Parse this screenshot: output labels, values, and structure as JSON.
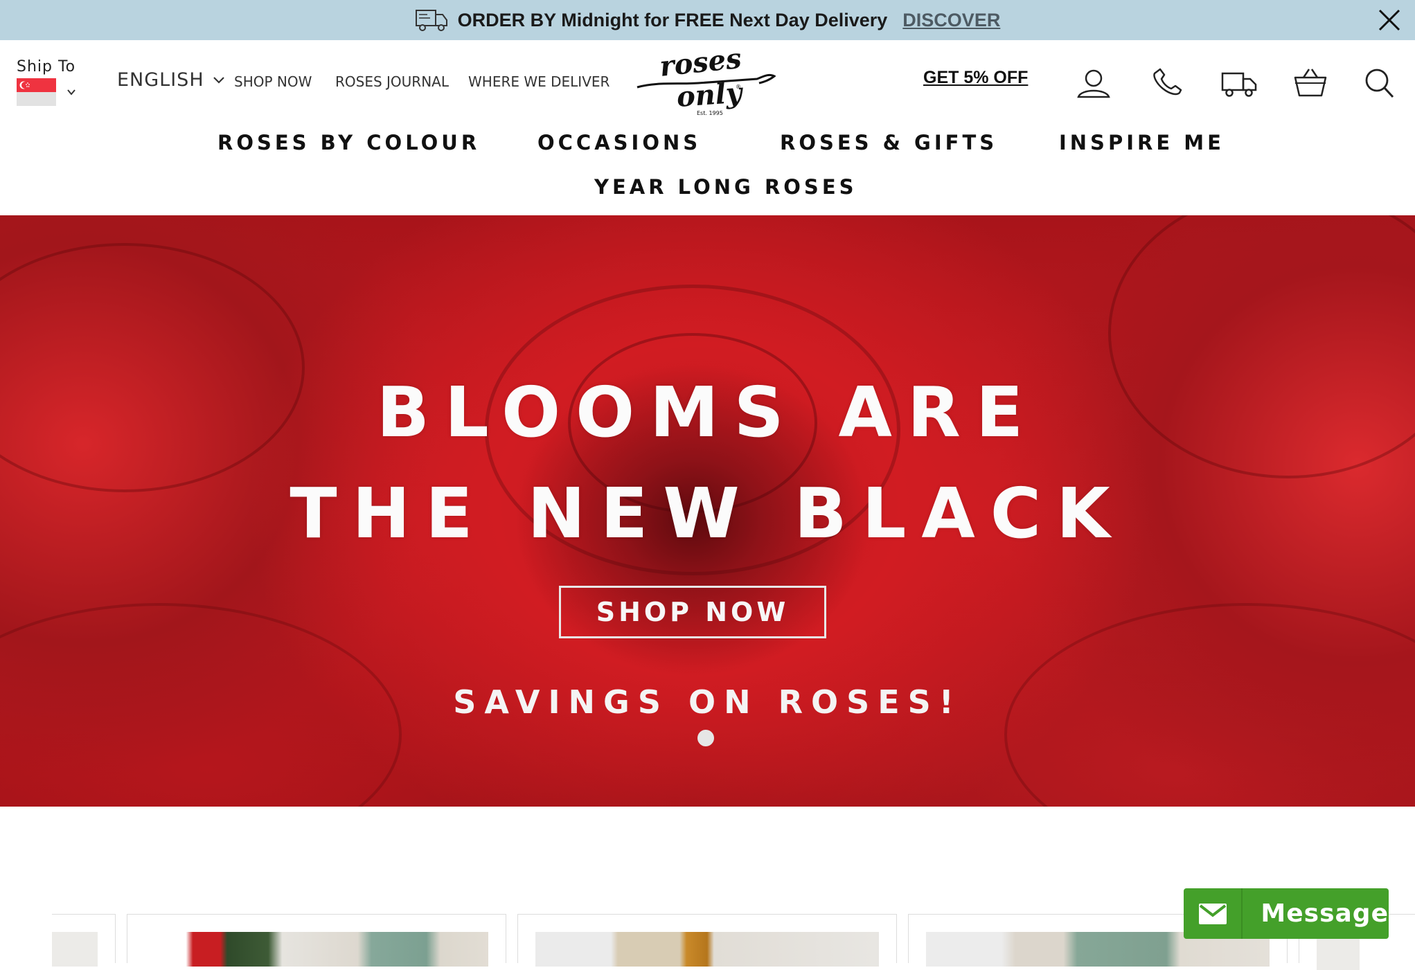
{
  "announcement": {
    "text": "ORDER BY Midnight for FREE Next Day Delivery",
    "link": "DISCOVER"
  },
  "ship_to": {
    "label": "Ship To",
    "country_flag": "singapore-flag"
  },
  "language": {
    "selected": "ENGLISH"
  },
  "top_links": [
    "SHOP NOW",
    "ROSES JOURNAL",
    "WHERE WE DELIVER"
  ],
  "logo": {
    "text": "roses only",
    "est": "Est. 1995"
  },
  "promo": "GET 5% OFF",
  "header_icons": [
    "account-icon",
    "phone-icon",
    "delivery-truck-icon",
    "basket-icon",
    "search-icon"
  ],
  "main_nav": [
    "ROSES BY COLOUR",
    "OCCASIONS",
    "ROSES & GIFTS",
    "INSPIRE ME",
    "YEAR LONG ROSES"
  ],
  "hero": {
    "line1": "BLOOMS ARE",
    "line2": "THE NEW BLACK",
    "button": "SHOP NOW",
    "subtitle": "SAVINGS ON ROSES!",
    "slides_active": 1
  },
  "message_widget": {
    "label": "Message"
  },
  "colors": {
    "announcement_bg": "#b9d3df",
    "hero_red": "#c8181e",
    "message_green": "#44a02a"
  }
}
